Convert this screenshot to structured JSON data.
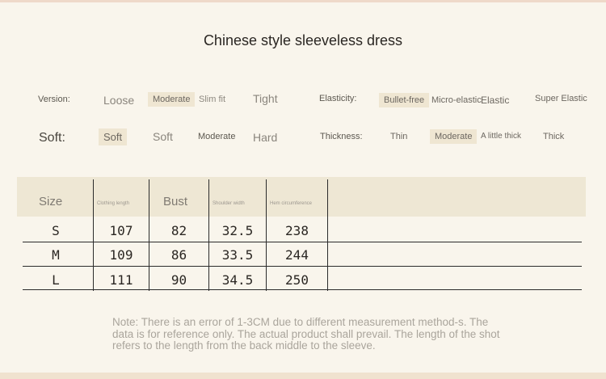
{
  "title": "Chinese style sleeveless dress",
  "attributes": {
    "version": {
      "label": "Version:",
      "options": [
        "Loose",
        "Moderate",
        "Slim fit",
        "Tight"
      ],
      "selected": "Moderate"
    },
    "elasticity": {
      "label": "Elasticity:",
      "options": [
        "Bullet-free",
        "Micro-elastic",
        "Elastic",
        "Super Elastic"
      ],
      "selected": "Bullet-free"
    },
    "soft": {
      "label": "Soft:",
      "options": [
        "Soft",
        "Soft",
        "Moderate",
        "Hard"
      ],
      "selected": "Soft"
    },
    "thickness": {
      "label": "Thickness:",
      "options": [
        "Thin",
        "Moderate",
        "A little thick",
        "Thick"
      ],
      "selected": "Moderate"
    }
  },
  "table": {
    "headers": [
      "Size",
      "Clothing length",
      "Bust",
      "Shoulder width",
      "Hem circumference"
    ],
    "rows": [
      [
        "S",
        "107",
        "82",
        "32.5",
        "238"
      ],
      [
        "M",
        "109",
        "86",
        "33.5",
        "244"
      ],
      [
        "L",
        "111",
        "90",
        "34.5",
        "250"
      ]
    ]
  },
  "note": "Note: There is an error of 1-3CM due to different measurement method-s. The data is for reference only. The actual product shall prevail. The length of the shot refers to the length from the back middle to the sleeve."
}
